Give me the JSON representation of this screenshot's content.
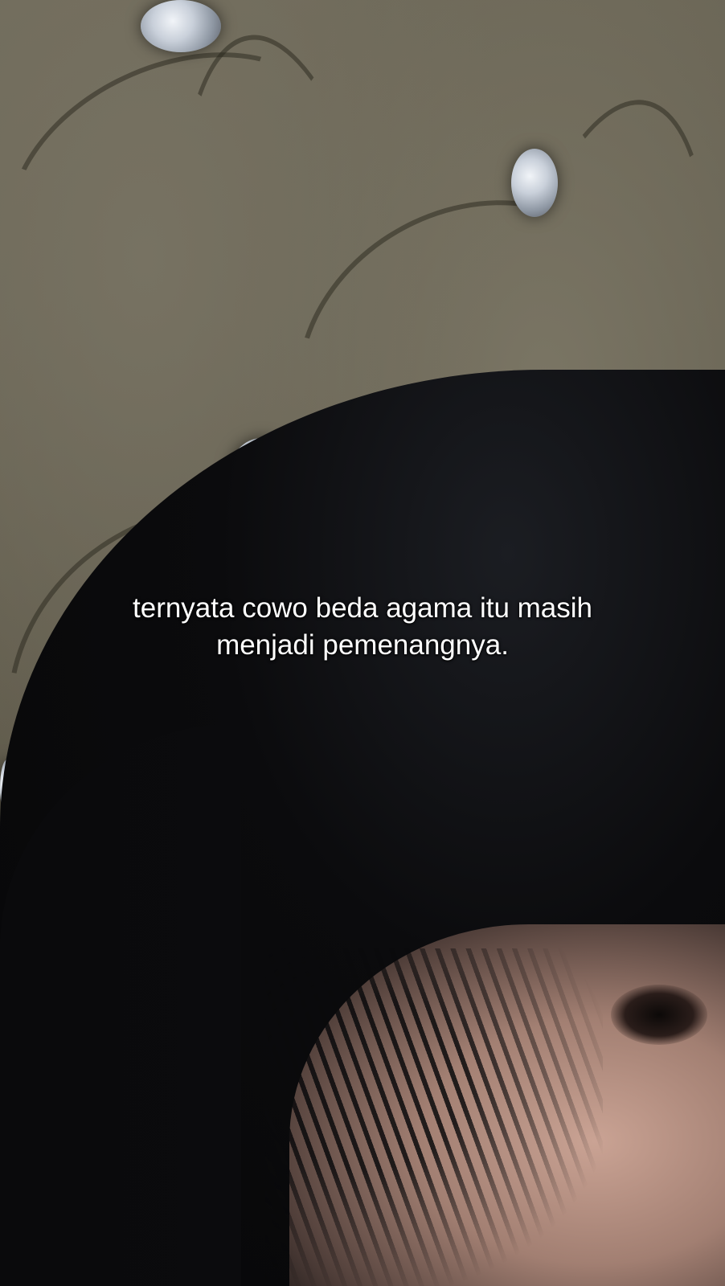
{
  "caption": {
    "line1": "ternyata cowo beda agama itu masih",
    "line2": "menjadi pemenangnya."
  },
  "colors": {
    "sofa": "#6b6656",
    "hair": "#0b0b0d",
    "skin": "#a27f72",
    "text": "#ffffff"
  }
}
